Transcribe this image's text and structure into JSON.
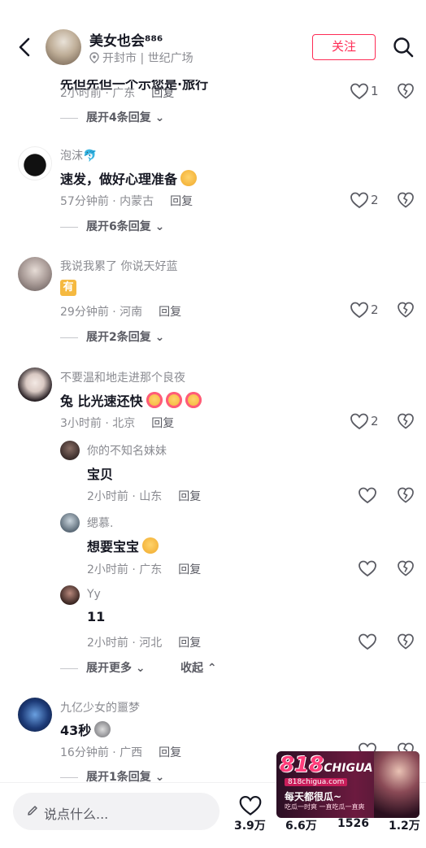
{
  "header": {
    "back_label": "back",
    "name": "美女也会⁸⁸⁶",
    "location": "开封市 | 世纪广场",
    "follow_label": "关注"
  },
  "cut_comment": {
    "text": "先但先但一个示您是·旅行"
  },
  "comments": [
    {
      "meta_time": "2小时前 · 广东",
      "reply_label": "回复",
      "likes": "1",
      "expand": "展开4条回复"
    },
    {
      "user": "泡沫🐬",
      "text": "速发，做好心理准备",
      "meta_time": "57分钟前 · 内蒙古",
      "reply_label": "回复",
      "likes": "2",
      "expand": "展开6条回复"
    },
    {
      "user": "我说我累了 你说天好蓝",
      "badge": "有",
      "meta_time": "29分钟前 · 河南",
      "reply_label": "回复",
      "likes": "2",
      "expand": "展开2条回复"
    },
    {
      "user": "不要温和地走进那个良夜",
      "text": "兔 比光速还快",
      "meta_time": "3小时前 · 北京",
      "reply_label": "回复",
      "likes": "2",
      "replies": [
        {
          "user": "你的不知名妹妹",
          "text": "宝贝",
          "meta_time": "2小时前 · 山东",
          "reply_label": "回复"
        },
        {
          "user": "缌慕.",
          "text": "想要宝宝",
          "meta_time": "2小时前 · 广东",
          "reply_label": "回复"
        },
        {
          "user": "Yy",
          "text": "11",
          "meta_time": "2小时前 · 河北",
          "reply_label": "回复"
        }
      ],
      "expand_more": "展开更多",
      "collapse": "收起"
    },
    {
      "user": "九亿少女的噩梦",
      "text": "43秒",
      "meta_time": "16分钟前 · 广西",
      "reply_label": "回复",
      "expand": "展开1条回复"
    }
  ],
  "bottom": {
    "placeholder": "说点什么...",
    "likes": "3.9万",
    "stat2": "6.6万",
    "stat3": "1526",
    "stat4": "1.2万"
  },
  "ad": {
    "logo": "818",
    "logo_sub": "CHIGUA",
    "url": "818chigua.com",
    "line1": "每天都很瓜~",
    "line2": "吃瓜一时爽 一直吃瓜一直爽"
  },
  "colors": {
    "accent": "#fe2c55",
    "text": "#161823",
    "muted": "#8a8b91"
  }
}
